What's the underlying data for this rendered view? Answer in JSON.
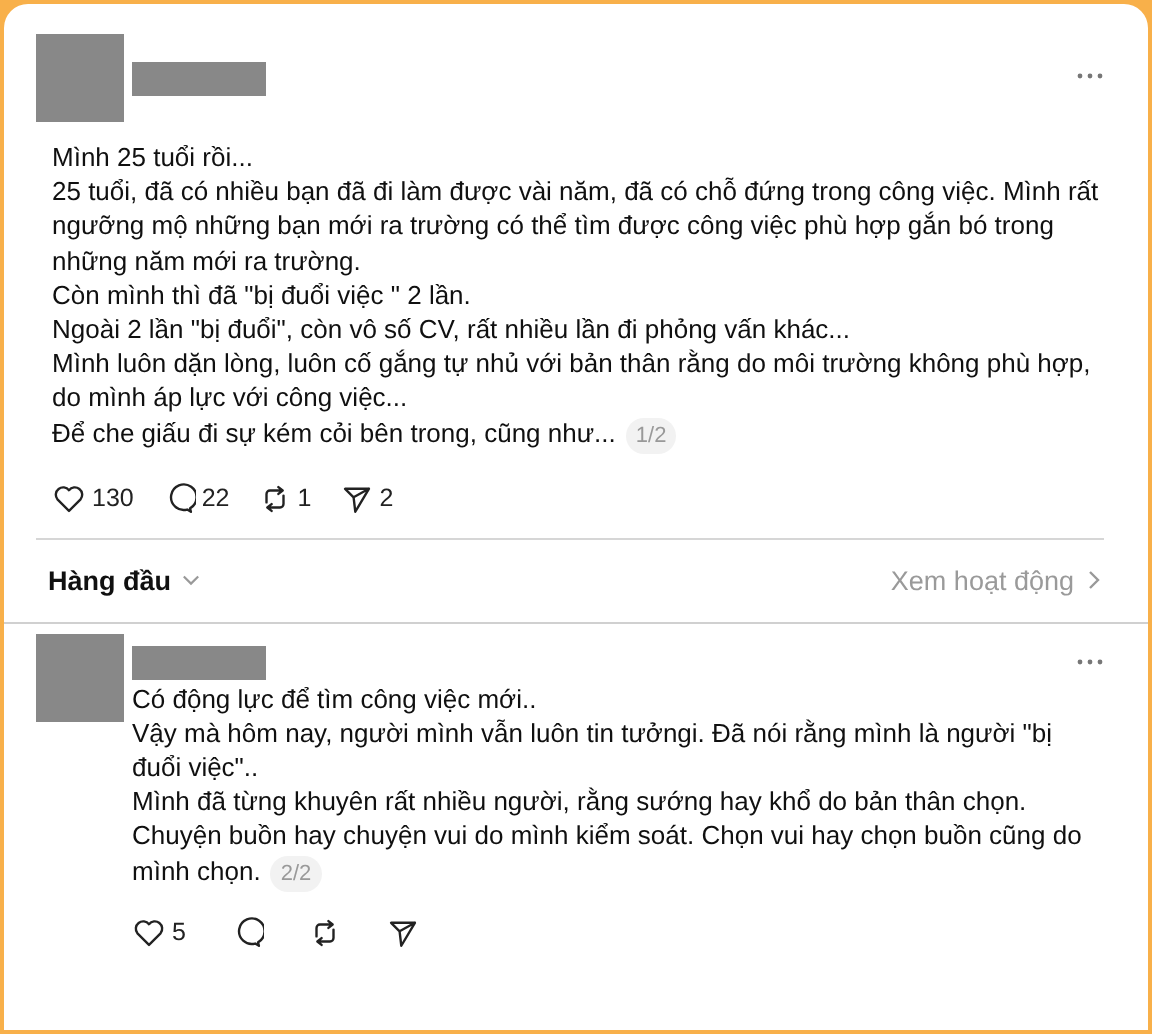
{
  "post": {
    "paragraphs": [
      "Mình 25 tuổi rồi...",
      "25 tuổi, đã có nhiều bạn đã đi làm được vài năm, đã có chỗ đứng trong công việc. Mình rất ngưỡng mộ những bạn mới ra trường có thể tìm được công việc phù hợp gắn bó trong những năm mới ra trường.",
      "Còn mình thì đã \"bị đuổi việc \" 2 lần.",
      "Ngoài 2 lần \"bị đuổi\", còn vô số CV, rất nhiều lần đi phỏng vấn khác...",
      "Mình luôn dặn lòng, luôn cố gắng tự nhủ với bản thân rằng do môi trường không phù hợp, do mình áp lực với công việc...",
      "Để che giấu đi sự kém cỏi bên trong, cũng như..."
    ],
    "page_badge": "1/2",
    "actions": [
      {
        "kind": "like",
        "count": "130"
      },
      {
        "kind": "reply",
        "count": "22"
      },
      {
        "kind": "repost",
        "count": "1"
      },
      {
        "kind": "share",
        "count": "2"
      }
    ]
  },
  "sort": {
    "label": "Hàng đầu",
    "activity_link": "Xem hoạt động"
  },
  "reply": {
    "paragraphs": [
      "Có động lực để tìm công việc mới..",
      "Vậy mà hôm nay, người mình vẫn luôn tin tưởngi. Đã nói rằng mình là người \"bị đuổi việc\"..",
      "Mình đã từng khuyên rất nhiều người, rằng sướng hay khổ do bản thân chọn. Chuyện buồn hay chuyện vui do mình kiểm soát. Chọn vui hay chọn buồn cũng do mình chọn."
    ],
    "page_badge": "2/2",
    "actions": [
      {
        "kind": "like",
        "count": "5"
      },
      {
        "kind": "reply"
      },
      {
        "kind": "repost"
      },
      {
        "kind": "share"
      }
    ]
  }
}
